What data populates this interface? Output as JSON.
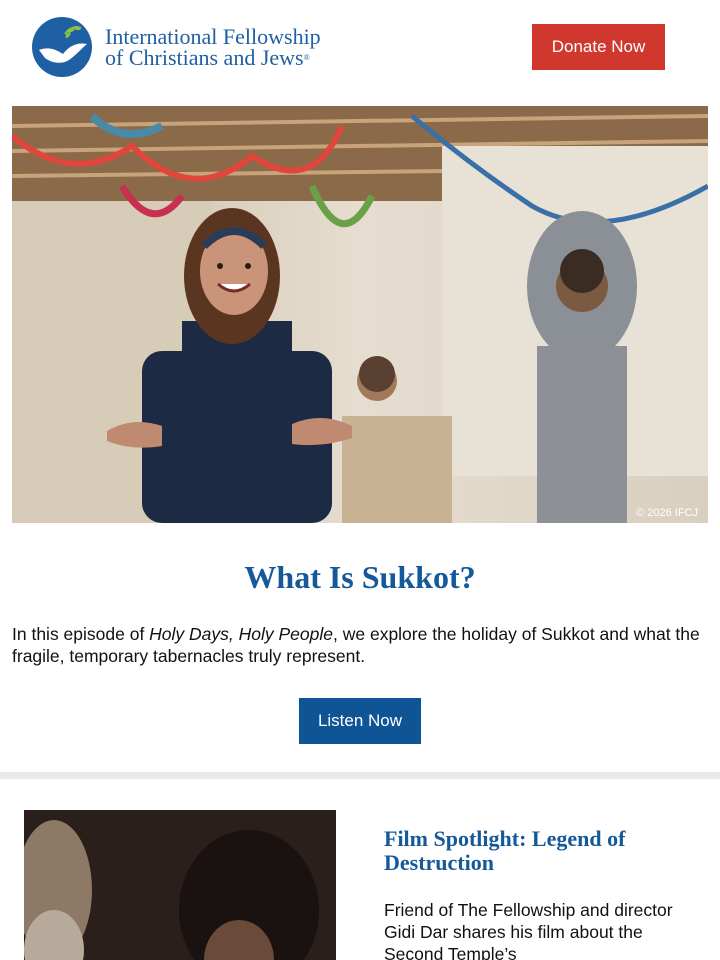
{
  "header": {
    "logo_line1": "International Fellowship",
    "logo_line2": "of Christians and Jews",
    "logo_mark": "®",
    "donate_label": "Donate Now"
  },
  "hero": {
    "image": "hero-photo",
    "copyright": "© 2026 IFCJ"
  },
  "feature": {
    "title": "What Is Sukkot?",
    "description_before": "In this episode of ",
    "description_italic": "Holy Days, Holy People",
    "description_after": ", we explore the holiday of Sukkot and what the fragile, temporary tabernacles truly represent.",
    "button_label": "Listen Now"
  },
  "film": {
    "title": "Film Spotlight: Legend of Destruction",
    "description": "Friend of The Fellowship and director Gidi Dar shares his film about the Second Temple’s"
  },
  "colors": {
    "brand_blue": "#15599b",
    "donate_red": "#d0382e",
    "button_blue": "#0f5494"
  }
}
